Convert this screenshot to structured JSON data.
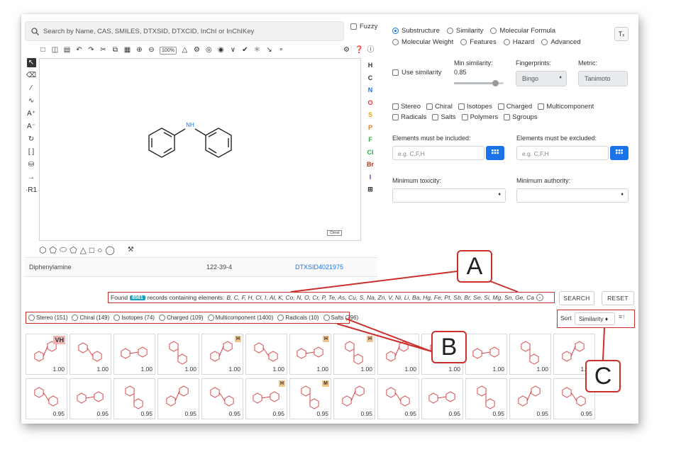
{
  "search": {
    "placeholder": "Search by Name, CAS, SMILES, DTXSID, DTXCID, InChI or InChIKey",
    "fuzzy_label": "Fuzzy"
  },
  "editor": {
    "zoom": "100%",
    "atom_list": [
      "H",
      "C",
      "N",
      "O",
      "S",
      "P",
      "F",
      "Cl",
      "Br",
      "I",
      "⊞"
    ],
    "atom_colors": [
      "#333",
      "#333",
      "#1a73e8",
      "#e53935",
      "#e6a800",
      "#e67e22",
      "#2ea84a",
      "#2ea84a",
      "#b03a2e",
      "#7b2fb5",
      "#333"
    ],
    "chiral_flag": "Chiral",
    "nh_label": "NH"
  },
  "compound": {
    "name": "Diphenylamine",
    "cas": "122-39-4",
    "dtxsid": "DTXSID4021975"
  },
  "modes": {
    "items": [
      "Substructure",
      "Similarity",
      "Molecular Formula",
      "Molecular Weight",
      "Features",
      "Hazard",
      "Advanced"
    ],
    "selected": "Substructure",
    "clear_icon": "clear-format-icon"
  },
  "similarity": {
    "use_label": "Use similarity",
    "min_label": "Min similarity:",
    "min_value": "0.85",
    "slider_fraction": 0.85,
    "fingerprint_label": "Fingerprints:",
    "fingerprint_value": "Bingo",
    "metric_label": "Metric:",
    "metric_value": "Tanimoto"
  },
  "filters": [
    "Stereo",
    "Chiral",
    "Isotopes",
    "Charged",
    "Multicomponent",
    "Radicals",
    "Salts",
    "Polymers",
    "Sgroups"
  ],
  "elements": {
    "include_label": "Elements must be included:",
    "include_placeholder": "e.g. C,F,H",
    "exclude_label": "Elements must be excluded:",
    "exclude_placeholder": "e.g. C,F,H"
  },
  "toxicity_label": "Minimum toxicity:",
  "authority_label": "Minimum authority:",
  "found": {
    "prefix": "Found",
    "count": "8581",
    "middle": "records containing elements:",
    "elements": "B, C, F, H, Cl, I, Al, K, Co, N, O, Cr, P, Te, As, Cu, S, Na, Zn, V, Ni, Li, Ba, Hg, Fe, Pt, Sb, Br, Se, Si, Mg, Sn, Ge, Ca"
  },
  "buttons": {
    "search": "SEARCH",
    "reset": "RESET"
  },
  "facets": [
    {
      "name": "Stereo",
      "count": "151"
    },
    {
      "name": "Chiral",
      "count": "149"
    },
    {
      "name": "Isotopes",
      "count": "74"
    },
    {
      "name": "Charged",
      "count": "109"
    },
    {
      "name": "Multicomponent",
      "count": "1400"
    },
    {
      "name": "Radicals",
      "count": "10"
    },
    {
      "name": "Salts",
      "count": "796"
    }
  ],
  "sort": {
    "label": "Sort",
    "value": "Similarity ♦",
    "direction_icon": "≡↑"
  },
  "results": [
    {
      "score": "1.00",
      "flag": "VH"
    },
    {
      "score": "1.00",
      "flag": ""
    },
    {
      "score": "1.00",
      "flag": ""
    },
    {
      "score": "1.00",
      "flag": ""
    },
    {
      "score": "1.00",
      "flag": "H"
    },
    {
      "score": "1.00",
      "flag": ""
    },
    {
      "score": "1.00",
      "flag": "H"
    },
    {
      "score": "1.00",
      "flag": "H"
    },
    {
      "score": "1.00",
      "flag": ""
    },
    {
      "score": "1.00",
      "flag": ""
    },
    {
      "score": "1.00",
      "flag": ""
    },
    {
      "score": "1.00",
      "flag": ""
    },
    {
      "score": "1.00",
      "flag": ""
    },
    {
      "score": "0.95",
      "flag": ""
    },
    {
      "score": "0.95",
      "flag": ""
    },
    {
      "score": "0.95",
      "flag": ""
    },
    {
      "score": "0.95",
      "flag": ""
    },
    {
      "score": "0.95",
      "flag": ""
    },
    {
      "score": "0.95",
      "flag": "H"
    },
    {
      "score": "0.95",
      "flag": "M"
    },
    {
      "score": "0.95",
      "flag": ""
    },
    {
      "score": "0.95",
      "flag": ""
    },
    {
      "score": "0.95",
      "flag": ""
    },
    {
      "score": "0.95",
      "flag": ""
    },
    {
      "score": "0.95",
      "flag": ""
    },
    {
      "score": "0.95",
      "flag": ""
    }
  ],
  "callouts": [
    "A",
    "B",
    "C"
  ]
}
